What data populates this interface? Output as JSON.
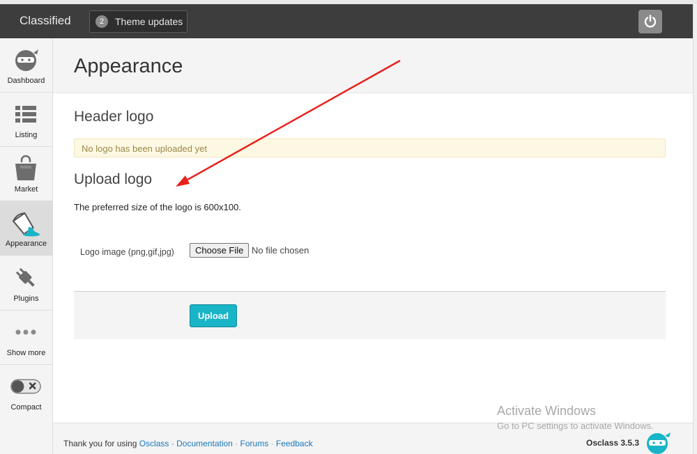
{
  "topbar": {
    "brand": "Classified",
    "theme_updates": {
      "count": "2",
      "label": "Theme updates"
    }
  },
  "sidebar": {
    "items": [
      {
        "label": "Dashboard",
        "icon": "ninja-icon"
      },
      {
        "label": "Listing",
        "icon": "list-icon"
      },
      {
        "label": "Market",
        "icon": "shopping-bag-icon"
      },
      {
        "label": "Appearance",
        "icon": "paint-bucket-icon",
        "active": true
      },
      {
        "label": "Plugins",
        "icon": "plug-icon"
      },
      {
        "label": "Show more",
        "icon": "ellipsis-icon"
      },
      {
        "label": "Compact",
        "icon": "toggle-icon"
      }
    ]
  },
  "page": {
    "title": "Appearance",
    "header_logo_heading": "Header logo",
    "alert": "No logo has been uploaded yet",
    "upload_logo_heading": "Upload logo",
    "preferred_size": "The preferred size of the logo is 600x100.",
    "form": {
      "logo_label": "Logo image (png,gif,jpg)",
      "choose_file": "Choose File",
      "no_file": "No file chosen",
      "upload_button": "Upload"
    }
  },
  "footer": {
    "thanks": "Thank you for using",
    "links": [
      "Osclass",
      "Documentation",
      "Forums",
      "Feedback"
    ],
    "separators": [
      "-",
      "·",
      "·"
    ],
    "version": "Osclass 3.5.3"
  },
  "watermark": {
    "line1": "Activate Windows",
    "line2": "Go to PC settings to activate Windows."
  },
  "colors": {
    "topbar": "#3d3d3d",
    "accent": "#18b4c7",
    "alert_bg": "#fdf8e3",
    "link": "#1a77b8",
    "annotation_arrow": "#e8201b"
  }
}
